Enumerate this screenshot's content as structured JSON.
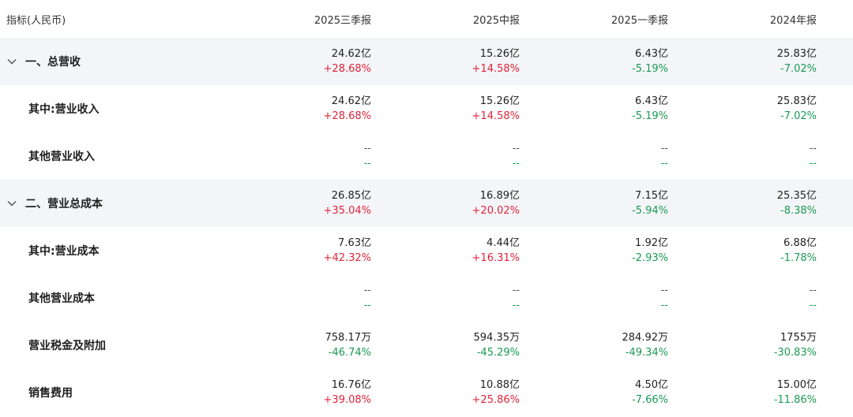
{
  "header": {
    "indicator": "指标(人民币)",
    "periods": [
      "2025三季报",
      "2025中报",
      "2025一季报",
      "2024年报"
    ]
  },
  "rows": [
    {
      "label": "一、总营收",
      "section": true,
      "values": [
        {
          "v": "24.62亿",
          "p": "+28.68%"
        },
        {
          "v": "15.26亿",
          "p": "+14.58%"
        },
        {
          "v": "6.43亿",
          "p": "-5.19%"
        },
        {
          "v": "25.83亿",
          "p": "-7.02%"
        }
      ]
    },
    {
      "label": "其中:营业收入",
      "section": false,
      "values": [
        {
          "v": "24.62亿",
          "p": "+28.68%"
        },
        {
          "v": "15.26亿",
          "p": "+14.58%"
        },
        {
          "v": "6.43亿",
          "p": "-5.19%"
        },
        {
          "v": "25.83亿",
          "p": "-7.02%"
        }
      ]
    },
    {
      "label": "其他营业收入",
      "section": false,
      "values": [
        {
          "v": "--",
          "p": "--"
        },
        {
          "v": "--",
          "p": "--"
        },
        {
          "v": "--",
          "p": "--"
        },
        {
          "v": "--",
          "p": "--"
        }
      ]
    },
    {
      "label": "二、营业总成本",
      "section": true,
      "values": [
        {
          "v": "26.85亿",
          "p": "+35.04%"
        },
        {
          "v": "16.89亿",
          "p": "+20.02%"
        },
        {
          "v": "7.15亿",
          "p": "-5.94%"
        },
        {
          "v": "25.35亿",
          "p": "-8.38%"
        }
      ]
    },
    {
      "label": "其中:营业成本",
      "section": false,
      "values": [
        {
          "v": "7.63亿",
          "p": "+42.32%"
        },
        {
          "v": "4.44亿",
          "p": "+16.31%"
        },
        {
          "v": "1.92亿",
          "p": "-2.93%"
        },
        {
          "v": "6.88亿",
          "p": "-1.78%"
        }
      ]
    },
    {
      "label": "其他营业成本",
      "section": false,
      "values": [
        {
          "v": "--",
          "p": "--"
        },
        {
          "v": "--",
          "p": "--"
        },
        {
          "v": "--",
          "p": "--"
        },
        {
          "v": "--",
          "p": "--"
        }
      ]
    },
    {
      "label": "营业税金及附加",
      "section": false,
      "values": [
        {
          "v": "758.17万",
          "p": "-46.74%"
        },
        {
          "v": "594.35万",
          "p": "-45.29%"
        },
        {
          "v": "284.92万",
          "p": "-49.34%"
        },
        {
          "v": "1755万",
          "p": "-30.83%"
        }
      ]
    },
    {
      "label": "销售费用",
      "section": false,
      "values": [
        {
          "v": "16.76亿",
          "p": "+39.08%"
        },
        {
          "v": "10.88亿",
          "p": "+25.86%"
        },
        {
          "v": "4.50亿",
          "p": "-7.66%"
        },
        {
          "v": "15.00亿",
          "p": "-11.86%"
        }
      ]
    }
  ],
  "colors": {
    "up": "#e1243a",
    "down": "#1a9a55",
    "section_bg": "#f4f5f8"
  },
  "icons": {
    "section_toggle": "chevron-down-icon"
  }
}
